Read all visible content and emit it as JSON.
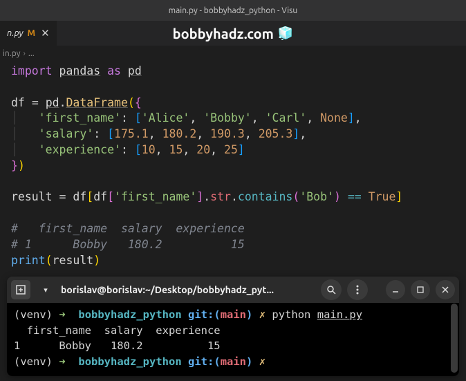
{
  "titlebar": "main.py - bobbyhadz_python - Visu",
  "tab": {
    "name": "n.py",
    "modified": "M"
  },
  "watermark": {
    "text": "bobbyhadz.com",
    "icon": "🧊"
  },
  "breadcrumb": {
    "file": "in.py",
    "sep": "›",
    "more": "..."
  },
  "code": {
    "l1": {
      "import": "import",
      "pandas": "pandas",
      "as": "as",
      "pd": "pd"
    },
    "l3": {
      "df": "df",
      "eq": "=",
      "pd": "pd",
      "dot": ".",
      "dataframe": "DataFrame",
      "lp": "(",
      "lb": "{"
    },
    "l4": {
      "key": "'first_name'",
      "colon": ":",
      "lb": "[",
      "v1": "'Alice'",
      "v2": "'Bobby'",
      "v3": "'Carl'",
      "v4": "None",
      "rb": "]",
      "comma": ","
    },
    "l5": {
      "key": "'salary'",
      "colon": ":",
      "lb": "[",
      "v1": "175.1",
      "v2": "180.2",
      "v3": "190.3",
      "v4": "205.3",
      "rb": "]",
      "comma": ","
    },
    "l6": {
      "key": "'experience'",
      "colon": ":",
      "lb": "[",
      "v1": "10",
      "v2": "15",
      "v3": "20",
      "v4": "25",
      "rb": "]"
    },
    "l7": {
      "rb": "}",
      "rp": ")"
    },
    "l9": {
      "result": "result",
      "eq": "=",
      "df": "df",
      "lb": "[",
      "df2": "df",
      "lb2": "[",
      "key": "'first_name'",
      "rb2": "]",
      "dot": ".",
      "str": "str",
      "dot2": ".",
      "contains": "contains",
      "lp": "(",
      "arg": "'Bob'",
      "rp": ")",
      "eqeq": "==",
      "true": "True",
      "rb": "]"
    },
    "l11": "#   first_name  salary  experience",
    "l12": "# 1      Bobby   180.2          15",
    "l13": {
      "print": "print",
      "lp": "(",
      "arg": "result",
      "rp": ")"
    }
  },
  "terminal": {
    "title": "borislav@borislav:~/Desktop/bobbyhadz_pyt...",
    "line1": {
      "venv": "(venv)",
      "arrow": "➜",
      "path": "bobbyhadz_python",
      "git": "git:",
      "lp": "(",
      "branch": "main",
      "rp": ")",
      "dirty": "✗",
      "cmd": "python",
      "file": "main.py"
    },
    "out1": "  first_name  salary  experience",
    "out2": "1      Bobby   180.2          15",
    "line2": {
      "venv": "(venv)",
      "arrow": "➜",
      "path": "bobbyhadz_python",
      "git": "git:",
      "lp": "(",
      "branch": "main",
      "rp": ")",
      "dirty": "✗"
    }
  }
}
